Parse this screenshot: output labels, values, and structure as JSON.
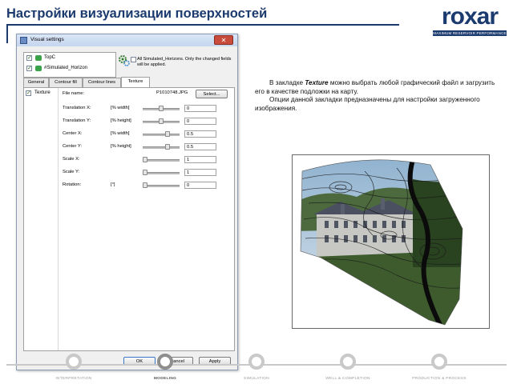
{
  "slide": {
    "title": "Настройки визуализации поверхностей"
  },
  "logo": {
    "name": "roxar",
    "tagline": "MAXIMUM RESERVOIR PERFORMANCE"
  },
  "dialog": {
    "title": "Visual settings",
    "horizons": [
      {
        "label": "TopC",
        "checked": true
      },
      {
        "label": "#Simulated_Horizon",
        "checked": true
      }
    ],
    "apply_all_text": "All Simulated_Horizons. Only the changed fields will be applied.",
    "tabs": [
      "General",
      "Contour fill",
      "Contour lines",
      "Texture"
    ],
    "active_tab": "Texture",
    "side_item": {
      "label": "Texture",
      "checked": true
    },
    "file_label": "File name:",
    "file_name": "P1010748.JPG",
    "select_button": "Select...",
    "params": [
      {
        "label": "Translation X:",
        "unit": "[% width]",
        "value": "0",
        "level": 0.5
      },
      {
        "label": "Translation Y:",
        "unit": "[% height]",
        "value": "0",
        "level": 0.5
      },
      {
        "label": "Center X:",
        "unit": "[% width]",
        "value": "0.5",
        "level": 0.7
      },
      {
        "label": "Center Y:",
        "unit": "[% height]",
        "value": "0.5",
        "level": 0.7
      },
      {
        "label": "Scale X:",
        "unit": "",
        "value": "1",
        "level": 0.0
      },
      {
        "label": "Scale Y:",
        "unit": "",
        "value": "1",
        "level": 0.0
      },
      {
        "label": "Rotation:",
        "unit": "[°]",
        "value": "0",
        "level": 0.0
      }
    ],
    "buttons": {
      "ok": "OK",
      "cancel": "Cancel",
      "apply": "Apply"
    }
  },
  "description": {
    "para1_prefix": "В закладке ",
    "para1_keyword": "Texture",
    "para1_suffix": " можно выбрать любой графический файл и загрузить его в качестве подложки на карту.",
    "para2": "Опции данной закладки предназначены для настройки загруженного изображения."
  },
  "workflow": {
    "steps": [
      {
        "label": "INTERPRETATION",
        "active": false
      },
      {
        "label": "MODELING",
        "active": true
      },
      {
        "label": "SIMULATION",
        "active": false
      },
      {
        "label": "WELL & COMPLETION",
        "active": false
      },
      {
        "label": "PRODUCTION & PROCESS",
        "active": false
      }
    ]
  },
  "colors": {
    "brand": "#1b3a6e",
    "nav_inactive": "#c9c9c9",
    "nav_active": "#8e8e8e"
  }
}
